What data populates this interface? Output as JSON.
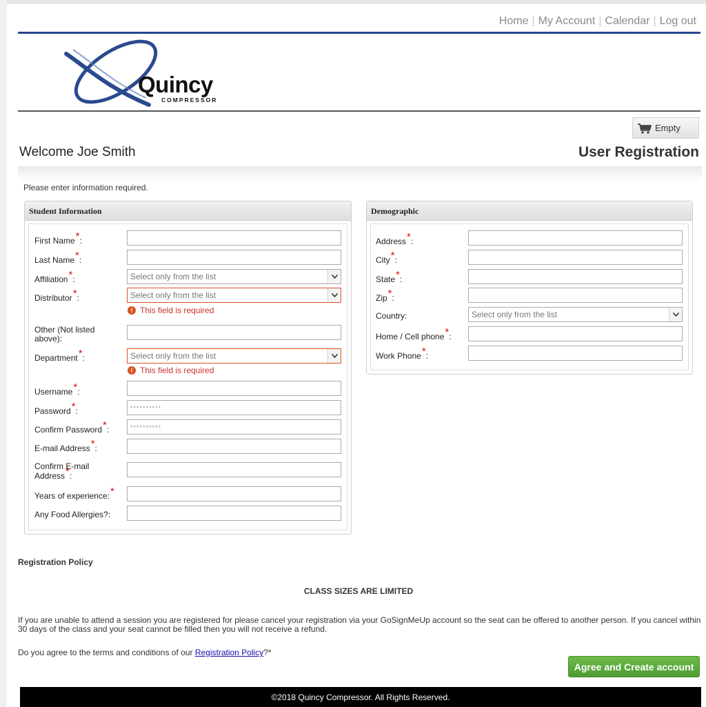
{
  "nav": {
    "home": "Home",
    "my_account": "My Account",
    "calendar": "Calendar",
    "logout": "Log out",
    "separator": "|"
  },
  "brand": {
    "name": "Quincy",
    "sub": "COMPRESSOR",
    "primary_color": "#24468c"
  },
  "cart": {
    "label": "Empty",
    "icon": "shopping-cart-icon"
  },
  "header": {
    "welcome": "Welcome Joe Smith",
    "title": "User Registration",
    "instructions": "Please enter information required."
  },
  "required_mark": "*",
  "student": {
    "title": "Student Information",
    "first_name": {
      "label": "First Name",
      "value": ""
    },
    "last_name": {
      "label": "Last Name",
      "value": ""
    },
    "affiliation": {
      "label": "Affiliation",
      "placeholder": "Select only from the list"
    },
    "distributor": {
      "label": "Distributor",
      "placeholder": "Select only from the list",
      "error": "This field is required"
    },
    "other": {
      "label": "Other (Not listed above):",
      "value": ""
    },
    "department": {
      "label": "Department",
      "placeholder": "Select only from the list",
      "error": "This field is required"
    },
    "username": {
      "label": "Username",
      "value": ""
    },
    "password": {
      "label": "Password",
      "value": "**********"
    },
    "confirm_password": {
      "label": "Confirm Password",
      "value": "**********"
    },
    "email": {
      "label": "E-mail Address",
      "value": ""
    },
    "confirm_email": {
      "label": "Confirm E-mail Address",
      "value": ""
    },
    "experience": {
      "label": "Years of experience:",
      "value": ""
    },
    "allergies": {
      "label": "Any Food Allergies?:",
      "value": ""
    }
  },
  "demographic": {
    "title": "Demographic",
    "address": {
      "label": "Address",
      "value": ""
    },
    "city": {
      "label": "City",
      "value": ""
    },
    "state": {
      "label": "State",
      "value": ""
    },
    "zip": {
      "label": "Zip",
      "value": ""
    },
    "country": {
      "label": "Country:",
      "placeholder": "Select only from the list"
    },
    "home_phone": {
      "label": "Home / Cell phone",
      "value": ""
    },
    "work_phone": {
      "label": "Work Phone",
      "value": ""
    }
  },
  "policy": {
    "heading": "Registration Policy",
    "class_sizes": "CLASS SIZES ARE LIMITED",
    "text": "If you are unable to attend a session you are registered for please cancel your registration via your GoSignMeUp account so the seat can be offered to another person. If you cancel within 30 days of the class and your seat cannot be filled then you will not receive a refund.",
    "agree_prefix": "Do you agree to the terms and conditions of our ",
    "agree_link": "Registration Policy",
    "agree_suffix": "?*"
  },
  "actions": {
    "agree_button": "Agree and Create account",
    "button_color": "#5aac3a"
  },
  "footer": {
    "copyright": "©2018 Quincy Compressor. All Rights Reserved."
  }
}
